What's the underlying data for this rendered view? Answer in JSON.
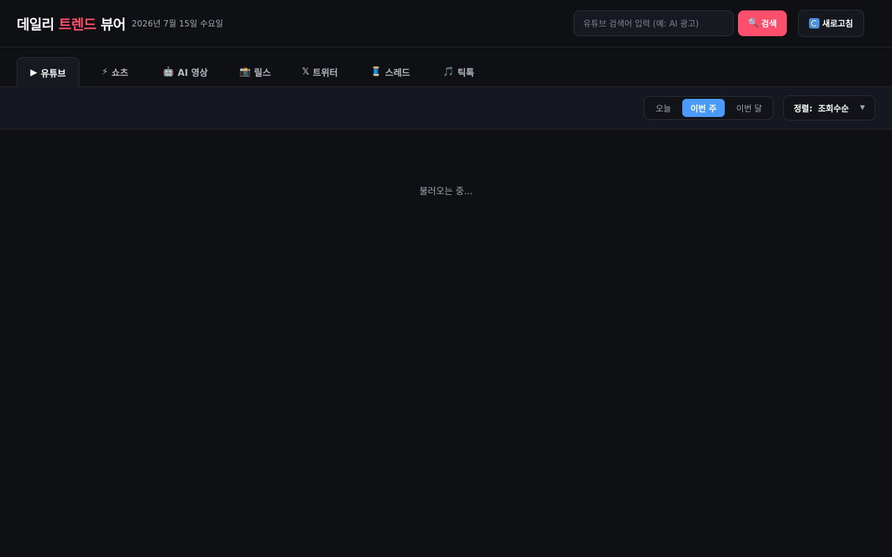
{
  "header": {
    "brand_prefix": "데일리",
    "brand_accent": "트렌드",
    "brand_suffix": "뷰어",
    "date": "2026년 7월 15일 수요일",
    "search_placeholder": "유튜브 검색어 입력 (예: AI 광고)",
    "search_label": "검색",
    "refresh_label": "새로고침"
  },
  "tabs": [
    {
      "icon": "▶",
      "label": "유튜브",
      "active": true
    },
    {
      "icon": "⚡",
      "label": "쇼츠"
    },
    {
      "icon": "🤖",
      "label": "AI 영상"
    },
    {
      "icon": "📸",
      "label": "릴스"
    },
    {
      "icon": "𝕏",
      "label": "트위터"
    },
    {
      "icon": "🧵",
      "label": "스레드"
    },
    {
      "icon": "🎵",
      "label": "틱톡"
    }
  ],
  "period": {
    "options": [
      "오늘",
      "이번 주",
      "이번 달"
    ],
    "selected": "이번 주"
  },
  "sort": {
    "label": "정렬:",
    "value": "조회수순"
  },
  "status": {
    "loading": "불러오는 중..."
  },
  "colors": {
    "accent": "#ff4f6d",
    "active_period": "#4b9bff",
    "background": "#0f1014"
  }
}
